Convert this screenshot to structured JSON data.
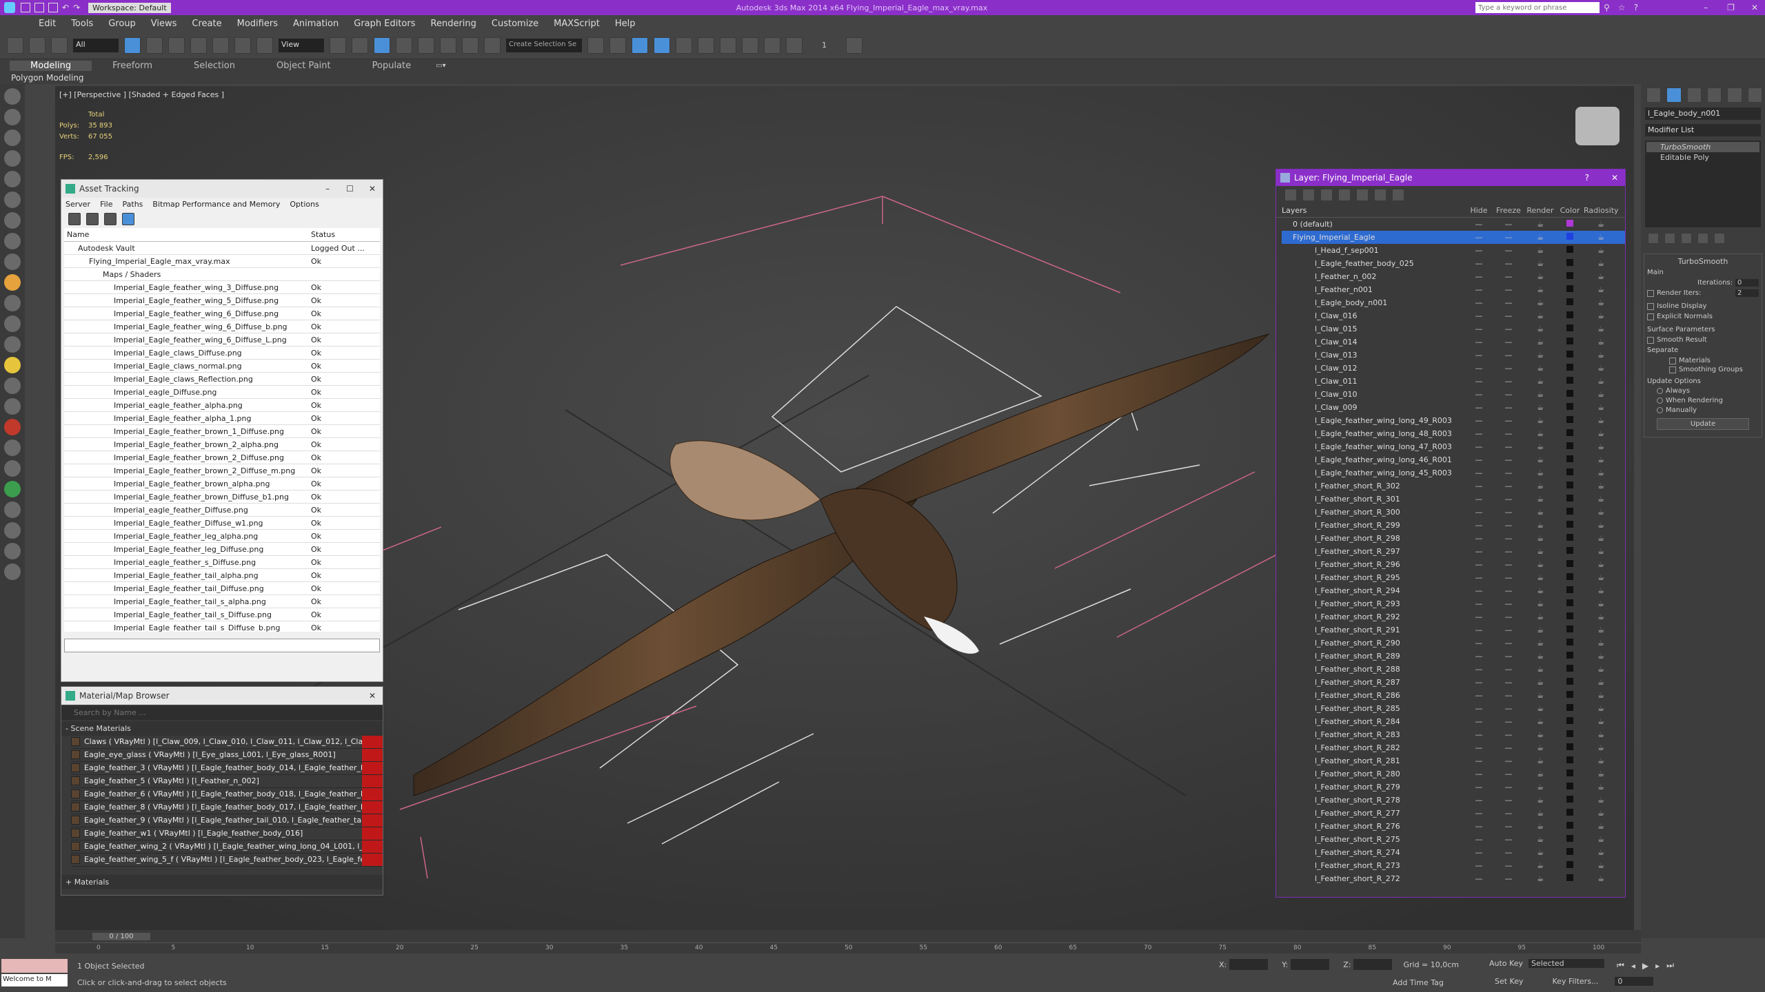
{
  "title": "Autodesk 3ds Max 2014 x64    Flying_Imperial_Eagle_max_vray.max",
  "workspace": "Workspace: Default",
  "search_placeholder": "Type a keyword or phrase",
  "menu": [
    "Edit",
    "Tools",
    "Group",
    "Views",
    "Create",
    "Modifiers",
    "Animation",
    "Graph Editors",
    "Rendering",
    "Customize",
    "MAXScript",
    "Help"
  ],
  "toolbar": {
    "filter": "All",
    "view": "View",
    "selection_set": "Create Selection Se",
    "snap_number": "1"
  },
  "ribbon": {
    "tabs": [
      "Modeling",
      "Freeform",
      "Selection",
      "Object Paint",
      "Populate"
    ],
    "sub": "Polygon Modeling"
  },
  "viewport": {
    "label": "[+] [Perspective ] [Shaded + Edged Faces ]",
    "stats_total": "Total",
    "polys_label": "Polys:",
    "polys": "35 893",
    "verts_label": "Verts:",
    "verts": "67 055",
    "fps_label": "FPS:",
    "fps": "2,596"
  },
  "asset": {
    "title": "Asset Tracking",
    "menu": [
      "Server",
      "File",
      "Paths",
      "Bitmap Performance and Memory",
      "Options"
    ],
    "cols": [
      "Name",
      "Status"
    ],
    "rows": [
      {
        "name": "Autodesk Vault",
        "status": "Logged Out ..."
      },
      {
        "name": "Flying_Imperial_Eagle_max_vray.max",
        "status": "Ok"
      },
      {
        "name": "Maps / Shaders",
        "status": ""
      },
      {
        "name": "Imperial_Eagle_feather_wing_3_Diffuse.png",
        "status": "Ok"
      },
      {
        "name": "Imperial_Eagle_feather_wing_5_Diffuse.png",
        "status": "Ok"
      },
      {
        "name": "Imperial_Eagle_feather_wing_6_Diffuse.png",
        "status": "Ok"
      },
      {
        "name": "Imperial_Eagle_feather_wing_6_Diffuse_b.png",
        "status": "Ok"
      },
      {
        "name": "Imperial_Eagle_feather_wing_6_Diffuse_L.png",
        "status": "Ok"
      },
      {
        "name": "Imperial_Eagle_claws_Diffuse.png",
        "status": "Ok"
      },
      {
        "name": "Imperial_Eagle_claws_normal.png",
        "status": "Ok"
      },
      {
        "name": "Imperial_Eagle_claws_Reflection.png",
        "status": "Ok"
      },
      {
        "name": "Imperial_eagle_Diffuse.png",
        "status": "Ok"
      },
      {
        "name": "Imperial_eagle_feather_alpha.png",
        "status": "Ok"
      },
      {
        "name": "Imperial_Eagle_feather_alpha_1.png",
        "status": "Ok"
      },
      {
        "name": "Imperial_Eagle_feather_brown_1_Diffuse.png",
        "status": "Ok"
      },
      {
        "name": "Imperial_Eagle_feather_brown_2_alpha.png",
        "status": "Ok"
      },
      {
        "name": "Imperial_Eagle_feather_brown_2_Diffuse.png",
        "status": "Ok"
      },
      {
        "name": "Imperial_Eagle_feather_brown_2_Diffuse_m.png",
        "status": "Ok"
      },
      {
        "name": "Imperial_Eagle_feather_brown_alpha.png",
        "status": "Ok"
      },
      {
        "name": "Imperial_Eagle_feather_brown_Diffuse_b1.png",
        "status": "Ok"
      },
      {
        "name": "Imperial_eagle_feather_Diffuse.png",
        "status": "Ok"
      },
      {
        "name": "Imperial_Eagle_feather_Diffuse_w1.png",
        "status": "Ok"
      },
      {
        "name": "Imperial_Eagle_feather_leg_alpha.png",
        "status": "Ok"
      },
      {
        "name": "Imperial_Eagle_feather_leg_Diffuse.png",
        "status": "Ok"
      },
      {
        "name": "Imperial_eagle_feather_s_Diffuse.png",
        "status": "Ok"
      },
      {
        "name": "Imperial_Eagle_feather_tail_alpha.png",
        "status": "Ok"
      },
      {
        "name": "Imperial_Eagle_feather_tail_Diffuse.png",
        "status": "Ok"
      },
      {
        "name": "Imperial_Eagle_feather_tail_s_alpha.png",
        "status": "Ok"
      },
      {
        "name": "Imperial_Eagle_feather_tail_s_Diffuse.png",
        "status": "Ok"
      },
      {
        "name": "Imperial_Eagle_feather_tail_s_Diffuse_b.png",
        "status": "Ok"
      }
    ]
  },
  "matbrowser": {
    "title": "Material/Map Browser",
    "search_placeholder": "Search by Name ...",
    "section": "- Scene Materials",
    "footer": "+ Materials",
    "items": [
      "Claws  ( VRayMtl ) [l_Claw_009, l_Claw_010, l_Claw_011, l_Claw_012, l_Cla...",
      "Eagle_eye_glass  ( VRayMtl ) [l_Eye_glass_L001, l_Eye_glass_R001]",
      "Eagle_feather_3  ( VRayMtl ) [l_Eagle_feather_body_014, l_Eagle_feather_bo...",
      "Eagle_feather_5  ( VRayMtl ) [l_Feather_n_002]",
      "Eagle_feather_6  ( VRayMtl ) [l_Eagle_feather_body_018, l_Eagle_feather_bo...",
      "Eagle_feather_8  ( VRayMtl ) [l_Eagle_feather_body_017, l_Eagle_feather_bo...",
      "Eagle_feather_9  ( VRayMtl ) [l_Eagle_feather_tail_010, l_Eagle_feather_tail_...",
      "Eagle_feather_w1  ( VRayMtl ) [l_Eagle_feather_body_016]",
      "Eagle_feather_wing_2  ( VRayMtl ) [l_Eagle_feather_wing_long_04_L001, l_E...",
      "Eagle_feather_wing_5_f  ( VRayMtl ) [l_Eagle_feather_body_023, l_Eagle_fea..."
    ]
  },
  "layer": {
    "title": "Layer: Flying_Imperial_Eagle",
    "cols": [
      "Layers",
      "Hide",
      "Freeze",
      "Render",
      "Color",
      "Radiosity"
    ],
    "items": [
      "0 (default)",
      "Flying_Imperial_Eagle",
      "l_Head_f_sep001",
      "l_Eagle_feather_body_025",
      "l_Feather_n_002",
      "l_Feather_n001",
      "l_Eagle_body_n001",
      "l_Claw_016",
      "l_Claw_015",
      "l_Claw_014",
      "l_Claw_013",
      "l_Claw_012",
      "l_Claw_011",
      "l_Claw_010",
      "l_Claw_009",
      "l_Eagle_feather_wing_long_49_R003",
      "l_Eagle_feather_wing_long_48_R003",
      "l_Eagle_feather_wing_long_47_R003",
      "l_Eagle_feather_wing_long_46_R001",
      "l_Eagle_feather_wing_long_45_R003",
      "l_Feather_short_R_302",
      "l_Feather_short_R_301",
      "l_Feather_short_R_300",
      "l_Feather_short_R_299",
      "l_Feather_short_R_298",
      "l_Feather_short_R_297",
      "l_Feather_short_R_296",
      "l_Feather_short_R_295",
      "l_Feather_short_R_294",
      "l_Feather_short_R_293",
      "l_Feather_short_R_292",
      "l_Feather_short_R_291",
      "l_Feather_short_R_290",
      "l_Feather_short_R_289",
      "l_Feather_short_R_288",
      "l_Feather_short_R_287",
      "l_Feather_short_R_286",
      "l_Feather_short_R_285",
      "l_Feather_short_R_284",
      "l_Feather_short_R_283",
      "l_Feather_short_R_282",
      "l_Feather_short_R_281",
      "l_Feather_short_R_280",
      "l_Feather_short_R_279",
      "l_Feather_short_R_278",
      "l_Feather_short_R_277",
      "l_Feather_short_R_276",
      "l_Feather_short_R_275",
      "l_Feather_short_R_274",
      "l_Feather_short_R_273",
      "l_Feather_short_R_272"
    ]
  },
  "right": {
    "object_name": "l_Eagle_body_n001",
    "modifier_list": "Modifier List",
    "stack": [
      "TurboSmooth",
      "Editable Poly"
    ],
    "ts_title": "TurboSmooth",
    "main": "Main",
    "iterations_label": "Iterations:",
    "iterations": "0",
    "render_iters_label": "Render Iters:",
    "render_iters": "2",
    "isoline": "Isoline Display",
    "explicit": "Explicit Normals",
    "surface": "Surface Parameters",
    "smooth_result": "Smooth Result",
    "separate": "Separate",
    "materials": "Materials",
    "smoothing_groups": "Smoothing Groups",
    "update_options": "Update Options",
    "always": "Always",
    "when_rendering": "When Rendering",
    "manually": "Manually",
    "update": "Update"
  },
  "timeline": {
    "frame": "0 / 100",
    "ticks": [
      "0",
      "5",
      "10",
      "15",
      "20",
      "25",
      "30",
      "35",
      "40",
      "45",
      "50",
      "55",
      "60",
      "65",
      "70",
      "75",
      "80",
      "85",
      "90",
      "95",
      "100"
    ]
  },
  "status": {
    "welcome": "Welcome to M",
    "selected": "1 Object Selected",
    "hint": "Click or click-and-drag to select objects",
    "x_label": "X:",
    "y_label": "Y:",
    "z_label": "Z:",
    "grid": "Grid = 10,0cm",
    "add_time_tag": "Add Time Tag",
    "auto_key": "Auto Key",
    "selected_drop": "Selected",
    "set_key": "Set Key",
    "key_filters": "Key Filters...",
    "frame": "0"
  }
}
